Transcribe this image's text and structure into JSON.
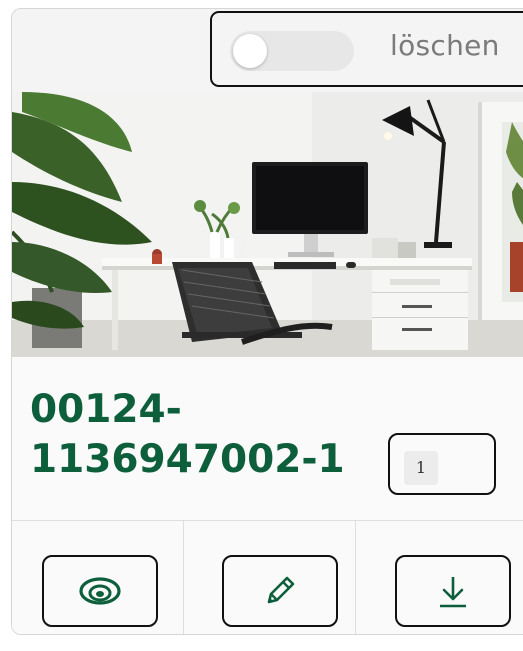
{
  "toggle": {
    "label": "löschen",
    "checked": false
  },
  "item": {
    "title_line1": "00124-",
    "title_line2": "1136947002-1",
    "badge_count": "1",
    "image_alt": "Schreibtisch mit Monitor, Lampe und Pflanzen"
  },
  "actions": [
    {
      "icon": "eye-icon"
    },
    {
      "icon": "pencil-icon"
    },
    {
      "icon": "download-icon"
    }
  ],
  "colors": {
    "title": "#0d5e3b",
    "icon": "#0d5e3b",
    "toggle_label": "#7b7b7b"
  }
}
